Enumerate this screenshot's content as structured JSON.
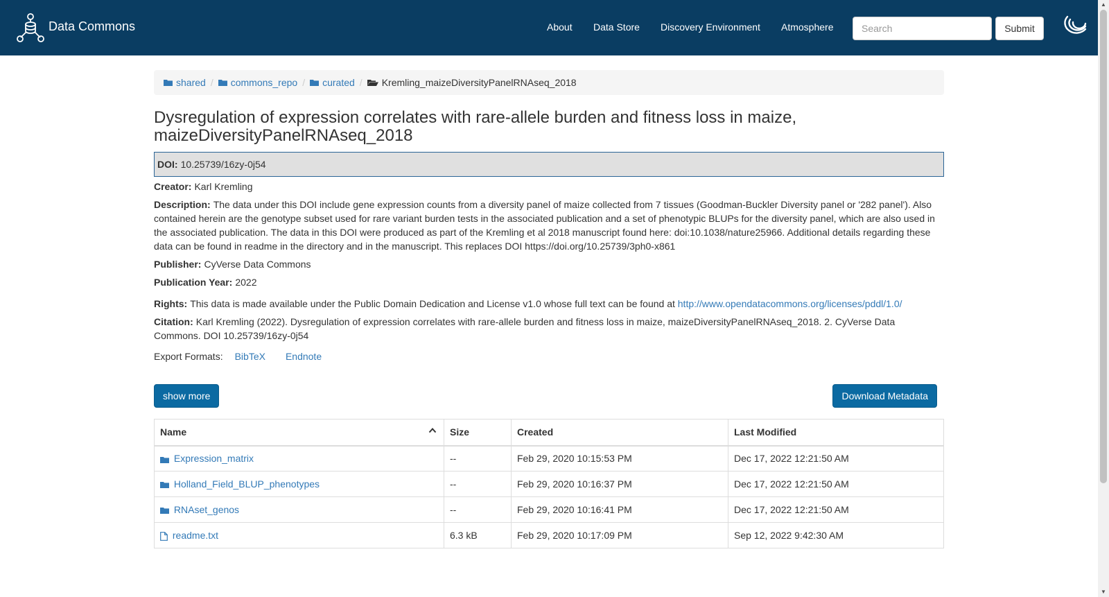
{
  "header": {
    "brand": "Data Commons",
    "nav": [
      "About",
      "Data Store",
      "Discovery Environment",
      "Atmosphere"
    ],
    "search_placeholder": "Search",
    "submit_label": "Submit"
  },
  "breadcrumb": [
    "shared",
    "commons_repo",
    "curated",
    "Kremling_maizeDiversityPanelRNAseq_2018"
  ],
  "title": "Dysregulation of expression correlates with rare-allele burden and fitness loss in maize, maizeDiversityPanelRNAseq_2018",
  "metadata": {
    "doi_label": "DOI:",
    "doi": "10.25739/16zy-0j54",
    "creator_label": "Creator:",
    "creator": "Karl Kremling",
    "description_label": "Description:",
    "description": "The data under this DOI include gene expression counts from a diversity panel of maize collected from 7 tissues (Goodman-Buckler Diversity panel or '282 panel'). Also contained herein are the genotype subset used for rare variant burden tests in the associated publication and a set of phenotypic BLUPs for the diversity panel, which are also used in the associated publication. The data in this DOI were produced as part of the Kremling et al 2018 manuscript found here: doi:10.1038/nature25966. Additional details regarding these data can be found in readme in the directory and in the manuscript. This replaces DOI https://doi.org/10.25739/3ph0-x861",
    "publisher_label": "Publisher:",
    "publisher": "CyVerse Data Commons",
    "year_label": "Publication Year:",
    "year": "2022",
    "rights_label": "Rights:",
    "rights": "This data is made available under the Public Domain Dedication and License v1.0 whose full text can be found at",
    "rights_link": "http://www.opendatacommons.org/licenses/pddl/1.0/",
    "citation_label": "Citation:",
    "citation": "Karl Kremling (2022). Dysregulation of expression correlates with rare-allele burden and fitness loss in maize, maizeDiversityPanelRNAseq_2018. 2. CyVerse Data Commons. DOI 10.25739/16zy-0j54",
    "export_label": "Export Formats:",
    "export_formats": [
      "BibTeX",
      "Endnote"
    ]
  },
  "buttons": {
    "show_more": "show more",
    "download_metadata": "Download Metadata"
  },
  "table": {
    "columns": [
      "Name",
      "Size",
      "Created",
      "Last Modified"
    ],
    "rows": [
      {
        "type": "folder",
        "name": "Expression_matrix",
        "size": "--",
        "created": "Feb 29, 2020 10:15:53 PM",
        "modified": "Dec 17, 2022 12:21:50 AM"
      },
      {
        "type": "folder",
        "name": "Holland_Field_BLUP_phenotypes",
        "size": "--",
        "created": "Feb 29, 2020 10:16:37 PM",
        "modified": "Dec 17, 2022 12:21:50 AM"
      },
      {
        "type": "folder",
        "name": "RNAset_genos",
        "size": "--",
        "created": "Feb 29, 2020 10:16:41 PM",
        "modified": "Dec 17, 2022 12:21:50 AM"
      },
      {
        "type": "file",
        "name": "readme.txt",
        "size": "6.3 kB",
        "created": "Feb 29, 2020 10:17:09 PM",
        "modified": "Sep 12, 2022 9:42:30 AM"
      }
    ]
  },
  "colors": {
    "navbar": "#0a3d62",
    "link": "#337ab7",
    "button": "#0b6aa2"
  }
}
